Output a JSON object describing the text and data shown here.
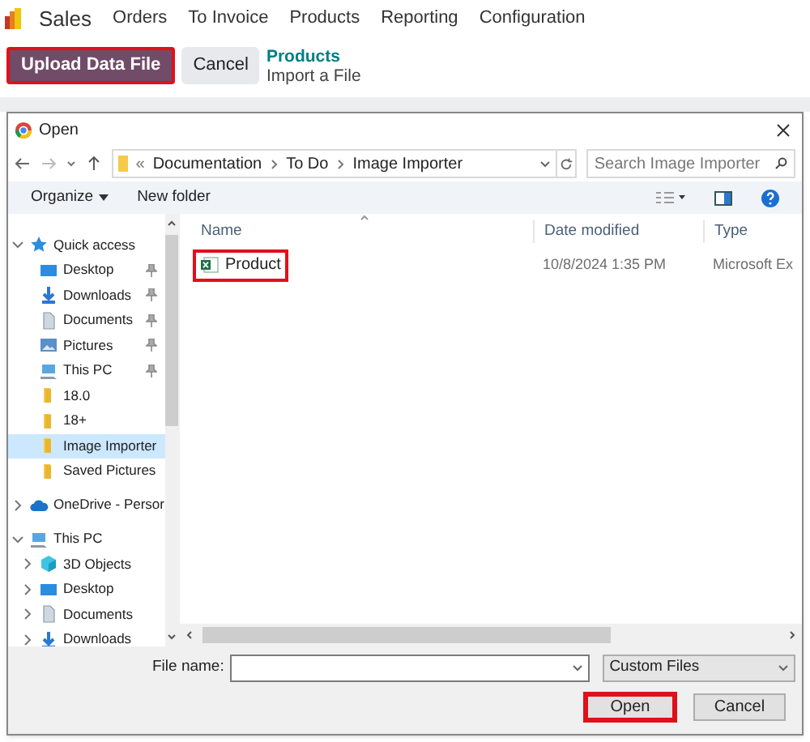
{
  "app_nav": {
    "app_name": "Sales",
    "menu": [
      "Orders",
      "To Invoice",
      "Products",
      "Reporting",
      "Configuration"
    ]
  },
  "control_bar": {
    "upload_button": {
      "label": "Upload Data File",
      "highlighted": true
    },
    "cancel_button": {
      "label": "Cancel"
    },
    "breadcrumb": {
      "parent": "Products",
      "current": "Import a File"
    }
  },
  "dialog": {
    "title": "Open",
    "address": {
      "separator": "«",
      "parts": [
        "Documentation",
        "To Do",
        "Image Importer"
      ]
    },
    "search": {
      "placeholder": "Search Image Importer"
    },
    "toolbar": {
      "organize": "Organize",
      "new_folder": "New folder"
    },
    "sidebar": [
      {
        "label": "Quick access",
        "kind": "star",
        "expanded": true,
        "children": [
          {
            "label": "Desktop",
            "kind": "desktop",
            "pinned": true,
            "selected": false
          },
          {
            "label": "Downloads",
            "kind": "downloads",
            "pinned": true,
            "selected": false
          },
          {
            "label": "Documents",
            "kind": "documents",
            "pinned": true,
            "selected": false
          },
          {
            "label": "Pictures",
            "kind": "pictures",
            "pinned": true,
            "selected": false
          },
          {
            "label": "This PC",
            "kind": "pc",
            "pinned": true,
            "selected": false
          },
          {
            "label": "18.0",
            "kind": "folder",
            "pinned": false,
            "selected": false
          },
          {
            "label": "18+",
            "kind": "folder",
            "pinned": false,
            "selected": false
          },
          {
            "label": "Image Importer",
            "kind": "folder",
            "pinned": false,
            "selected": true
          },
          {
            "label": "Saved Pictures",
            "kind": "folder",
            "pinned": false,
            "selected": false
          }
        ]
      },
      {
        "label": "OneDrive - Persor",
        "kind": "cloud",
        "expanded": false
      },
      {
        "label": "This PC",
        "kind": "pc",
        "expanded": true,
        "children": [
          {
            "label": "3D Objects",
            "kind": "cube",
            "expandable": true,
            "selected": false
          },
          {
            "label": "Desktop",
            "kind": "desktop",
            "expandable": true,
            "selected": false
          },
          {
            "label": "Documents",
            "kind": "documents",
            "expandable": true,
            "selected": false
          },
          {
            "label": "Downloads",
            "kind": "downloads",
            "expandable": true,
            "selected": false
          }
        ]
      }
    ],
    "columns": [
      "Name",
      "Date modified",
      "Type"
    ],
    "files": [
      {
        "name": "Product",
        "date_modified": "10/8/2024 1:35 PM",
        "type": "Microsoft Ex",
        "highlighted": true
      }
    ],
    "file_name": {
      "label": "File name:"
    },
    "file_type": "Custom Files",
    "open_button": {
      "label": "Open",
      "highlighted": true
    },
    "cancel_button": {
      "label": "Cancel"
    }
  }
}
